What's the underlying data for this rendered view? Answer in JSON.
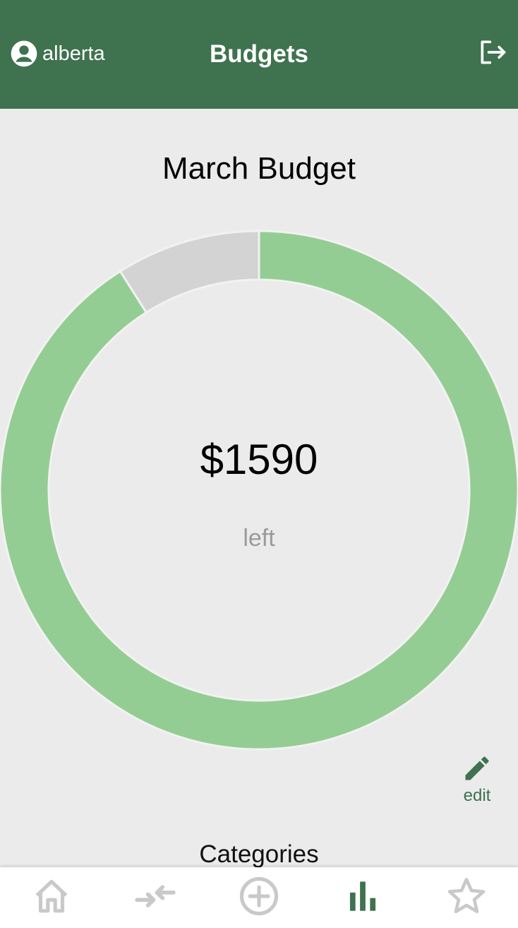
{
  "header": {
    "username": "alberta",
    "title": "Budgets",
    "user_icon": "account-circle-icon",
    "logout_icon": "logout-icon",
    "background": "#3f724f"
  },
  "budget": {
    "title": "March Budget",
    "amount_left": "$1590",
    "left_label": "left",
    "spent_fraction": 0.09,
    "remaining_color": "#94cd93",
    "spent_color": "#d3d3d3"
  },
  "edit": {
    "label": "edit",
    "icon": "pencil-icon"
  },
  "categories": {
    "title": "Categories"
  },
  "bottom_nav": {
    "items": [
      {
        "name": "home",
        "icon": "home-icon",
        "active": false
      },
      {
        "name": "transfers",
        "icon": "transfer-arrows-icon",
        "active": false
      },
      {
        "name": "add",
        "icon": "add-circle-icon",
        "active": false
      },
      {
        "name": "budgets",
        "icon": "bar-chart-icon",
        "active": true
      },
      {
        "name": "favorites",
        "icon": "star-icon",
        "active": false
      }
    ],
    "active_color": "#3f724f",
    "inactive_color": "#c9c9c9"
  }
}
